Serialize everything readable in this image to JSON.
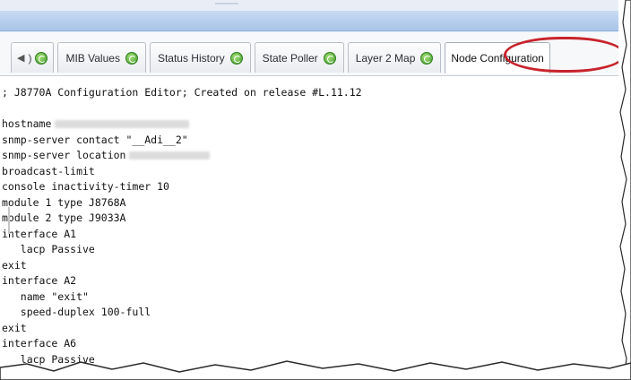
{
  "tabs": [
    {
      "label": ")",
      "scroll": true
    },
    {
      "label": "MIB Values"
    },
    {
      "label": "Status History"
    },
    {
      "label": "State Poller"
    },
    {
      "label": "Layer 2 Map"
    },
    {
      "label": "Node Configuration",
      "active": true
    }
  ],
  "editor": {
    "lines": {
      "l0": "; J8770A Configuration Editor; Created on release #L.11.12",
      "l1": "",
      "l2": "hostname",
      "l3": "snmp-server contact \"__Adi__2\"",
      "l4": "snmp-server location",
      "l5": "broadcast-limit",
      "l6": "console inactivity-timer 10",
      "l7": "module 1 type J8768A",
      "l8": "module 2 type J9033A",
      "l9": "interface A1",
      "l10": "   lacp Passive",
      "l11": "exit",
      "l12": "interface A2",
      "l13": "   name \"exit\"",
      "l14": "   speed-duplex 100-full",
      "l15": "exit",
      "l16": "interface A6",
      "l17": "   lacp Passive"
    }
  },
  "colors": {
    "callout": "#c8232c",
    "refresh": "#3f9a2a",
    "header_blue": "#a9c5e8"
  },
  "icons": {
    "refresh": "refresh-icon",
    "scroll_left": "chevron-left-icon"
  }
}
